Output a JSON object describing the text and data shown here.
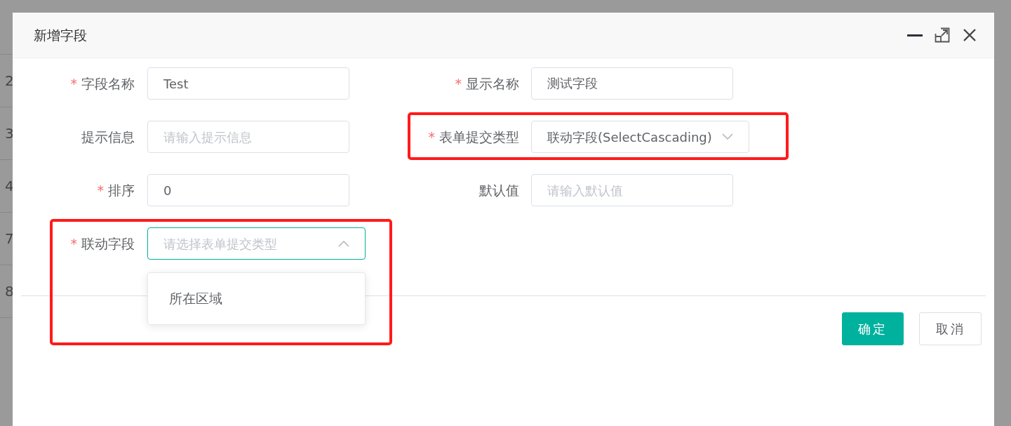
{
  "background_table": {
    "rows": [
      "2",
      "3",
      "4",
      "7",
      "8"
    ]
  },
  "dialog": {
    "title": "新增字段",
    "fields": [
      {
        "label": "字段名称",
        "required_mark": "*",
        "kind": "input",
        "value": "Test"
      },
      {
        "label": "显示名称",
        "required_mark": "*",
        "kind": "input",
        "value": "测试字段"
      },
      {
        "label": "提示信息",
        "kind": "input",
        "placeholder": "请输入提示信息"
      },
      {
        "label": "表单提交类型",
        "required_mark": "*",
        "kind": "select",
        "value": "联动字段(SelectCascading)",
        "expanded": false,
        "highlighted": true
      },
      {
        "label": "排序",
        "required_mark": "*",
        "kind": "input",
        "value": "0"
      },
      {
        "label": "默认值",
        "kind": "input",
        "placeholder": "请输入默认值"
      },
      {
        "label": "联动字段",
        "required_mark": "*",
        "kind": "select",
        "placeholder": "请选择表单提交类型",
        "expanded": true,
        "highlighted": true,
        "options": [
          {
            "label": "所在区域",
            "selected": false
          }
        ]
      }
    ],
    "buttons": [
      {
        "label": "确定",
        "kind": "primary"
      },
      {
        "label": "取消",
        "kind": "default"
      }
    ]
  }
}
